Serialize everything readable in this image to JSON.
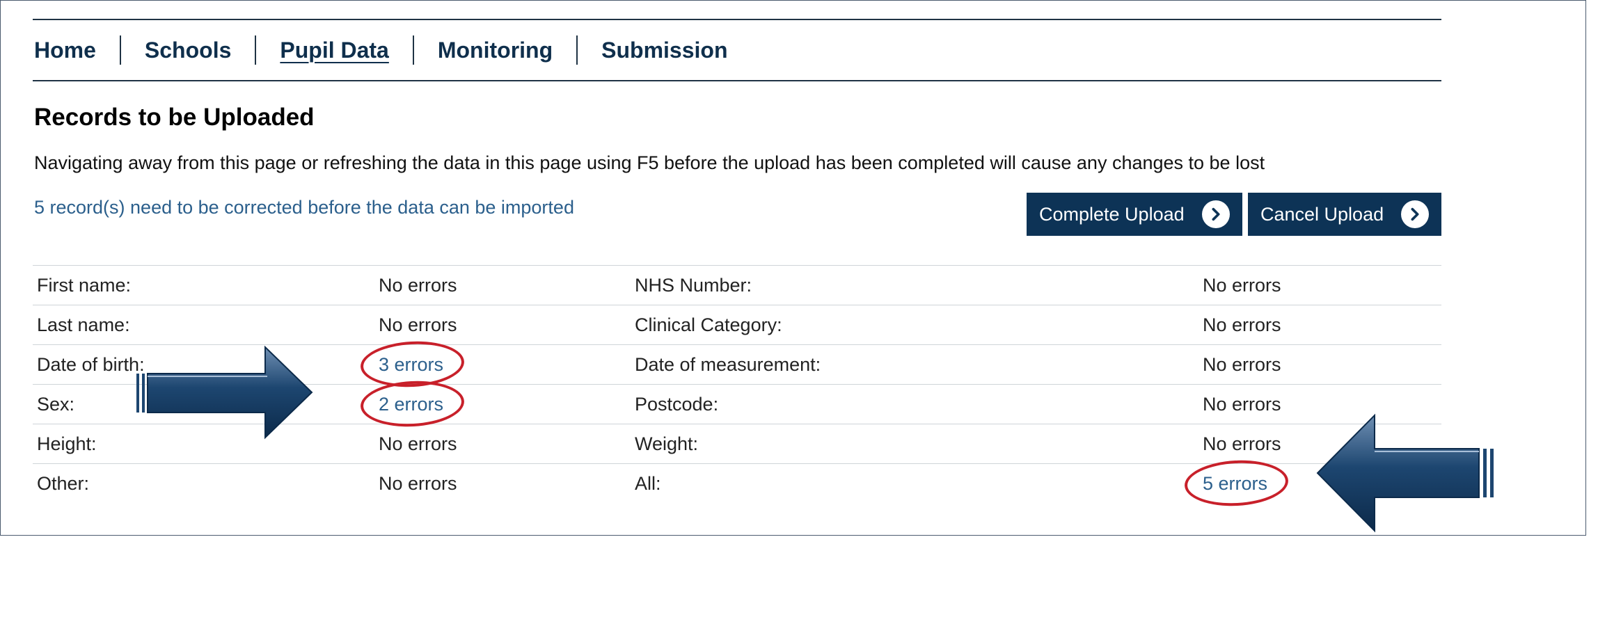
{
  "nav": {
    "items": [
      {
        "label": "Home",
        "active": false
      },
      {
        "label": "Schools",
        "active": false
      },
      {
        "label": "Pupil Data",
        "active": true
      },
      {
        "label": "Monitoring",
        "active": false
      },
      {
        "label": "Submission",
        "active": false
      }
    ]
  },
  "page": {
    "title": "Records to be Uploaded",
    "warning": "Navigating away from this page or refreshing the data in this page using F5 before the upload has been completed will cause any changes to be lost",
    "correction_notice": "5 record(s) need to be corrected before the data can be imported"
  },
  "buttons": {
    "complete_label": "Complete Upload",
    "cancel_label": "Cancel Upload"
  },
  "summary": {
    "rows": [
      {
        "field1": "First name:",
        "value1": "No errors",
        "field2": "NHS Number:",
        "value2": "No errors"
      },
      {
        "field1": "Last name:",
        "value1": "No errors",
        "field2": "Clinical Category:",
        "value2": "No errors"
      },
      {
        "field1": "Date of birth:",
        "value1": "3 errors",
        "field2": "Date of measurement:",
        "value2": "No errors"
      },
      {
        "field1": "Sex:",
        "value1": "2 errors",
        "field2": "Postcode:",
        "value2": "No errors"
      },
      {
        "field1": "Height:",
        "value1": "No errors",
        "field2": "Weight:",
        "value2": "No errors"
      },
      {
        "field1": "Other:",
        "value1": "No errors",
        "field2": "All:",
        "value2": "5 errors"
      }
    ]
  },
  "colors": {
    "nav_text": "#0f2f4c",
    "button_bg": "#0d3356",
    "link": "#2b5f8c",
    "highlight_circle": "#c8202a",
    "arrow": "#1d4670"
  },
  "icons": {
    "button_chevron": "chevron-right-circle-icon",
    "annotation_arrow": "arrow-icon"
  }
}
